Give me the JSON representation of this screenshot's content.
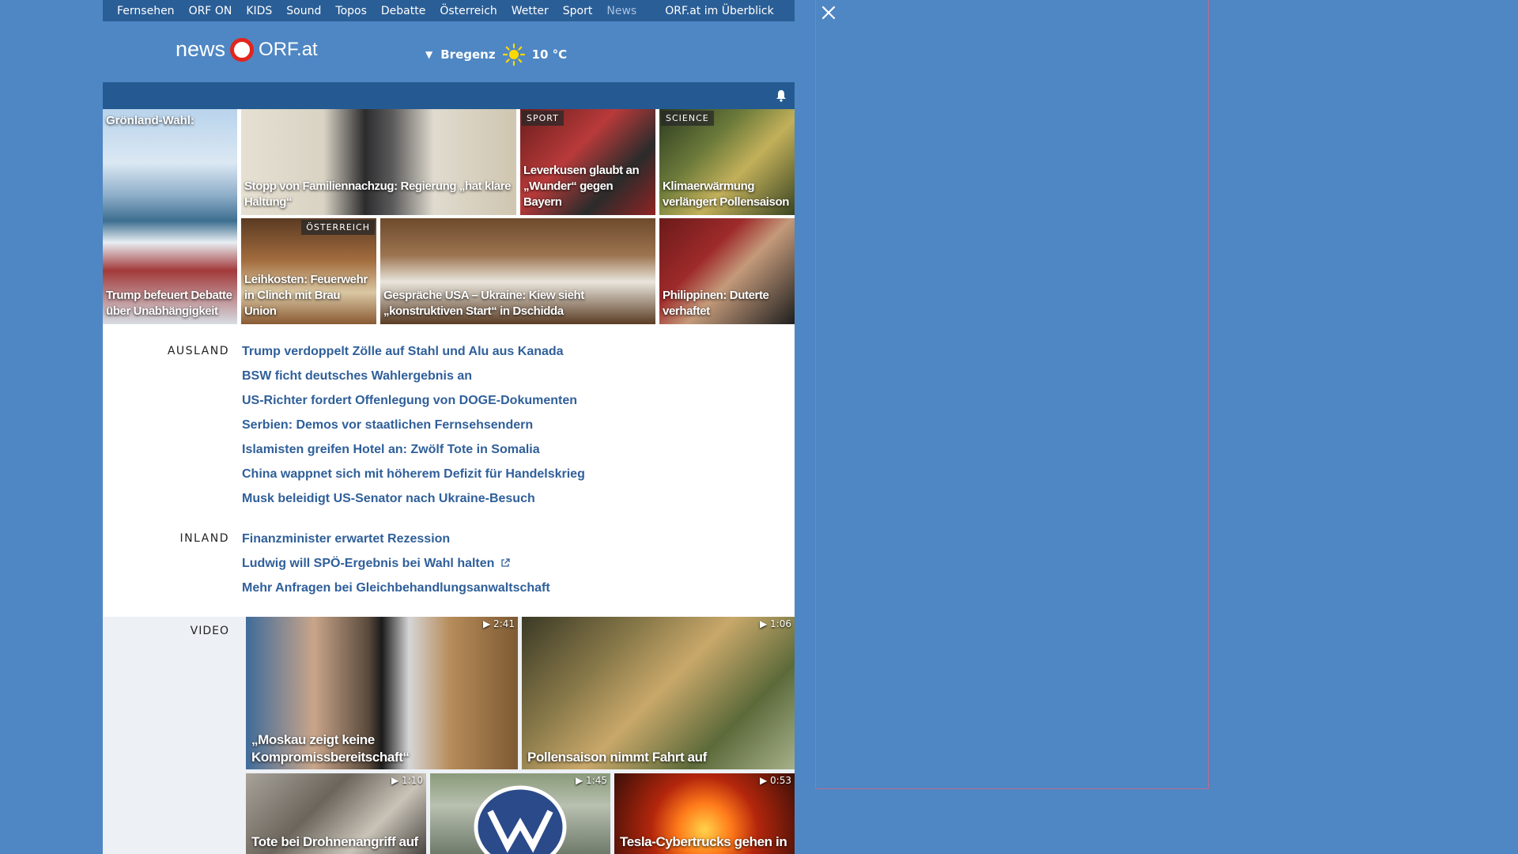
{
  "nav": {
    "items": [
      "Fernsehen",
      "ORF ON",
      "KIDS",
      "Sound",
      "Topos",
      "Debatte",
      "Österreich",
      "Wetter",
      "Sport"
    ],
    "current": "News",
    "overview": "ORF.at im Überblick"
  },
  "logo": {
    "news": "news",
    "orf": "ORF.at"
  },
  "weather": {
    "location": "Bregenz",
    "temp": "10 °C",
    "icon": "sun-icon"
  },
  "tiles": [
    {
      "caption_top": "Grönland-Wahl:",
      "caption": "Trump befeuert Debatte über Unabhängigkeit"
    },
    {
      "caption": "Stopp von Familiennachzug: Regierung „hat klare Haltung“",
      "label": ""
    },
    {
      "caption": "Leverkusen glaubt an „Wunder“ gegen Bayern",
      "label": "SPORT"
    },
    {
      "caption": "Klimaerwärmung verlängert Pollensaison",
      "label": "SCIENCE"
    },
    {
      "caption": "Leihkosten: Feuerwehr in Clinch mit Brau Union",
      "label": "ÖSTERREICH"
    },
    {
      "caption": "Gespräche USA – Ukraine: Kiew sieht „konstruktiven Start“ in Dschidda"
    },
    {
      "caption": "Philippinen: Duterte verhaftet"
    }
  ],
  "sections": {
    "ausland": {
      "label": "AUSLAND",
      "items": [
        "Trump verdoppelt Zölle auf Stahl und Alu aus Kanada",
        "BSW ficht deutsches Wahlergebnis an",
        "US-Richter fordert Offenlegung von DOGE-Dokumenten",
        "Serbien: Demos vor staatlichen Fernsehsendern",
        "Islamisten greifen Hotel an: Zwölf Tote in Somalia",
        "China wappnet sich mit höherem Defizit für Handelskrieg",
        "Musk beleidigt US-Senator nach Ukraine-Besuch"
      ]
    },
    "inland": {
      "label": "INLAND",
      "items": [
        "Finanzminister erwartet Rezession",
        "Ludwig will SPÖ-Ergebnis bei Wahl halten",
        "Mehr Anfragen bei Gleichbehandlungsanwaltschaft"
      ]
    }
  },
  "video": {
    "label": "VIDEO",
    "items": [
      {
        "caption": "„Moskau zeigt keine Kompromissbereitschaft“",
        "duration": "▶ 2:41"
      },
      {
        "caption": "Pollensaison nimmt Fahrt auf",
        "duration": "▶ 1:06"
      },
      {
        "caption": "Tote bei Drohnenangriff auf",
        "duration": "▶ 1:10"
      },
      {
        "caption": "",
        "duration": "▶ 1:45"
      },
      {
        "caption": "Tesla-Cybertrucks gehen in",
        "duration": "▶ 0:53"
      }
    ]
  },
  "colors": {
    "background": "#4f87c4",
    "nav": "#2a5e96",
    "link": "#2f5f9a",
    "orf_red": "#e2251d"
  }
}
